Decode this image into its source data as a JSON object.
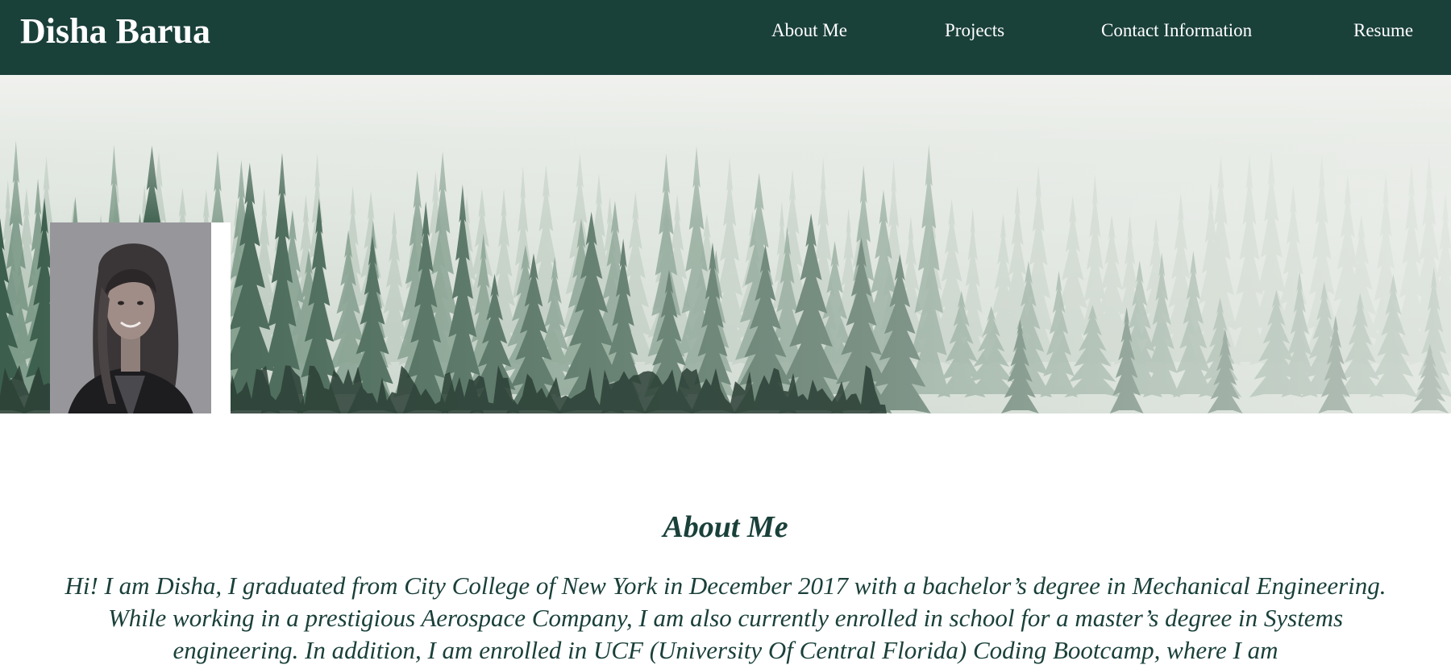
{
  "header": {
    "brand": "Disha Barua",
    "nav": [
      {
        "label": "About Me"
      },
      {
        "label": "Projects"
      },
      {
        "label": "Contact Information"
      },
      {
        "label": "Resume"
      }
    ],
    "background_color": "#1a403a"
  },
  "hero": {
    "image": "misty-pine-forest",
    "portrait": "profile-photo"
  },
  "about": {
    "heading": "About Me",
    "text": "Hi! I am Disha, I graduated from City College of New York in December 2017 with a bachelor’s degree in Mechanical Engineering. While working in a prestigious Aerospace Company, I am also currently enrolled in school for a master’s degree in Systems engineering. In addition, I am enrolled in UCF (University Of Central Florida) Coding Bootcamp, where I am",
    "text_color": "#1a403a"
  }
}
